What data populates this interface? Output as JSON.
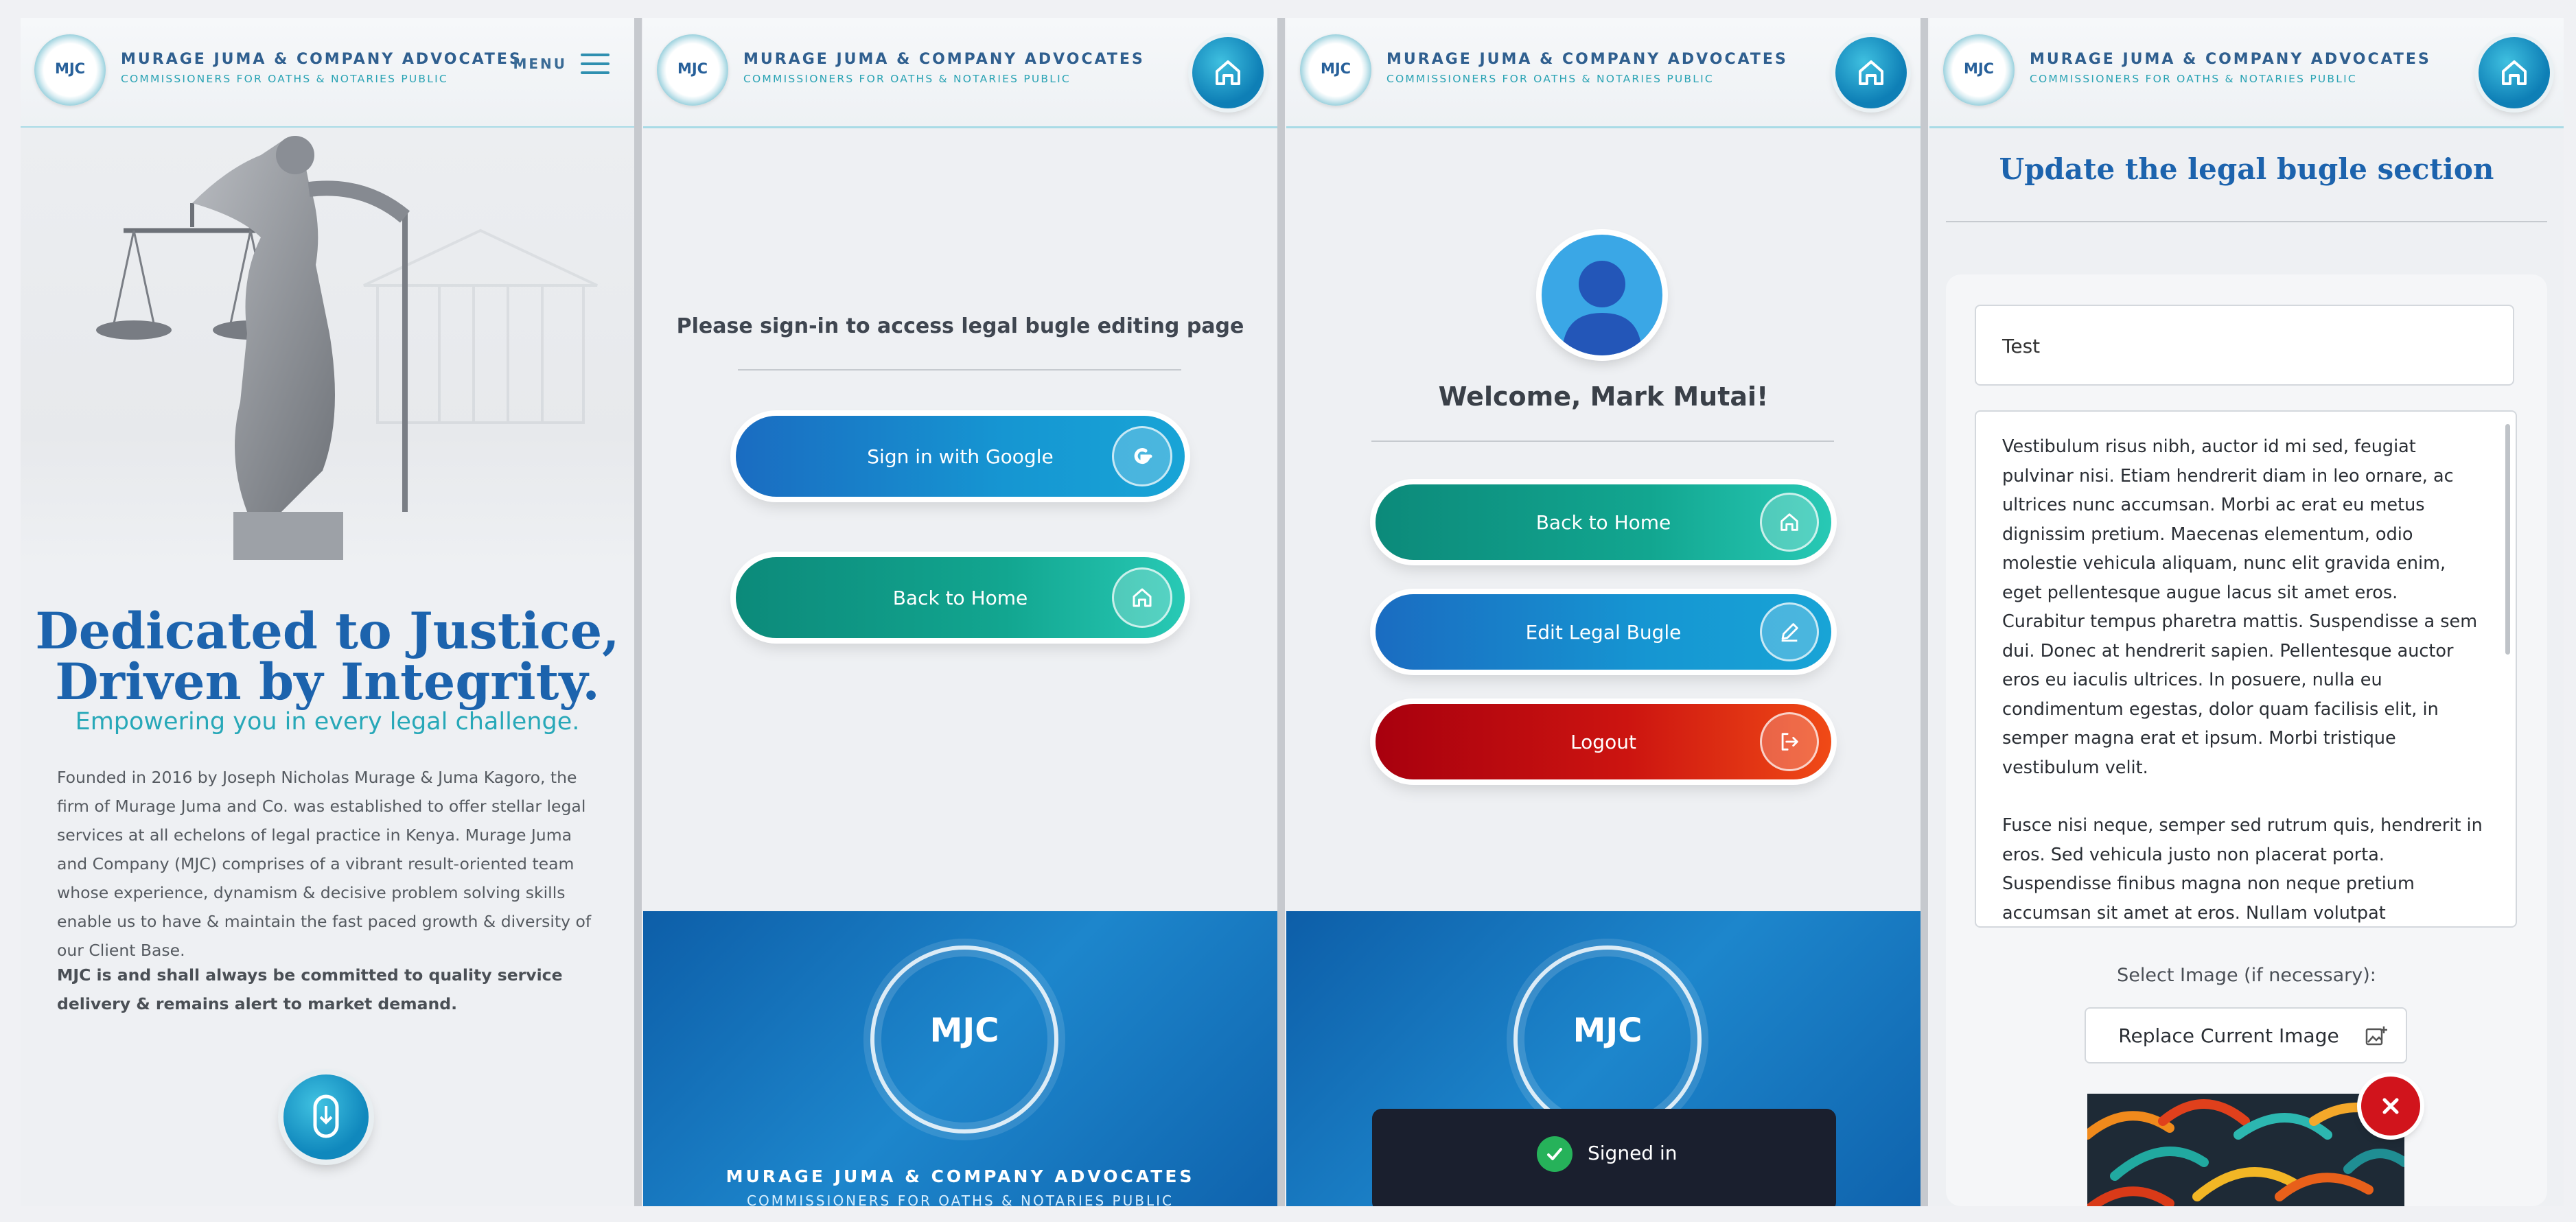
{
  "header": {
    "logo_text": "MJC",
    "firm_name": "MURAGE JUMA & COMPANY ADVOCATES",
    "firm_sub": "COMMISSIONERS FOR OATHS & NOTARIES PUBLIC",
    "menu_label": "MENU"
  },
  "home": {
    "headline_line1": "Dedicated to Justice,",
    "headline_line2": "Driven by Integrity.",
    "tagline": "Empowering you in every legal challenge.",
    "para1": "Founded in 2016 by Joseph Nicholas Murage & Juma Kagoro, the firm of Murage Juma and Co. was established to offer stellar legal services at all echelons of legal practice in Kenya. Murage Juma and Company (MJC) comprises of a vibrant result-oriented team whose experience, dynamism & decisive problem solving skills enable us to have & maintain the fast paced growth & diversity of our Client Base.",
    "para2": "MJC is and shall always be committed to quality service delivery & remains alert to market demand."
  },
  "signin": {
    "prompt": "Please sign-in to access legal bugle editing page",
    "google_label": "Sign in with Google",
    "back_label": "Back to Home"
  },
  "footer": {
    "logo_text": "MJC",
    "firm_name": "MURAGE JUMA & COMPANY ADVOCATES",
    "firm_sub": "COMMISSIONERS FOR OATHS & NOTARIES PUBLIC"
  },
  "dashboard": {
    "welcome": "Welcome, Mark Mutai!",
    "back_label": "Back to Home",
    "edit_label": "Edit Legal Bugle",
    "logout_label": "Logout",
    "toast": "Signed in"
  },
  "editor": {
    "title": "Update the legal bugle section",
    "title_value": "Test",
    "body_p1": "Vestibulum risus nibh, auctor id mi sed, feugiat pulvinar nisi. Etiam hendrerit diam in leo ornare, ac ultrices nunc accumsan. Morbi ac erat eu metus dignissim pretium. Maecenas elementum, odio molestie vehicula aliquam, nunc elit gravida enim, eget pellentesque augue lacus sit amet eros. Curabitur tempus pharetra mattis. Suspendisse a sem dui. Donec at hendrerit sapien. Pellentesque auctor eros eu iaculis ultrices. In posuere, nulla eu condimentum egestas, dolor quam facilisis elit, in semper magna erat et ipsum. Morbi tristique vestibulum velit.",
    "body_p2": "Fusce nisi neque, semper sed rutrum quis, hendrerit in eros. Sed vehicula justo non placerat porta. Suspendisse finibus magna non neque pretium accumsan sit amet at eros. Nullam volutpat ullamcorper diam, ut auctor tellus porttitor in. Quisque et finibus ligula. Aenean gravida",
    "select_label": "Select Image (if necessary):",
    "replace_label": "Replace Current Image"
  },
  "colors": {
    "brand_blue": "#1c63ad",
    "brand_teal": "#27a8b8",
    "logout_red": "#cc1410"
  }
}
